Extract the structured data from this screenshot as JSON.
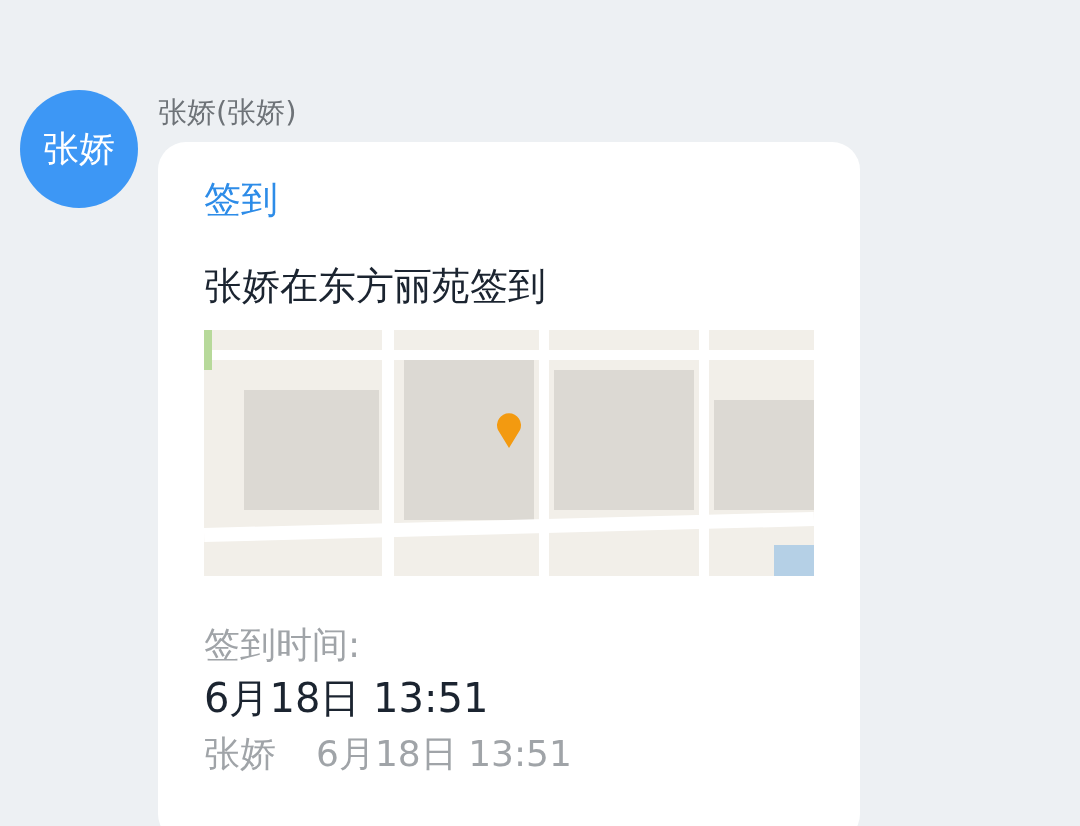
{
  "message": {
    "avatar_text": "张娇",
    "sender": "张娇(张娇)",
    "card": {
      "title": "签到",
      "heading": "张娇在东方丽苑签到",
      "time_label": "签到时间:",
      "time_value": "6月18日 13:51",
      "footer_name": "张娇",
      "footer_time": "6月18日 13:51"
    }
  }
}
